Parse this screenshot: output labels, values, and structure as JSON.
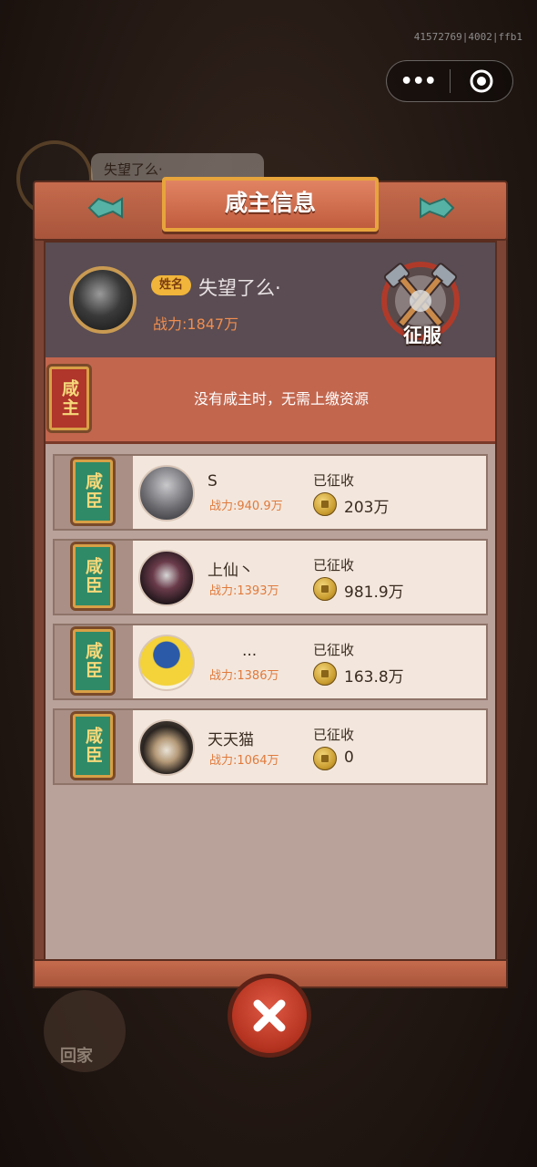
{
  "debug_id": "41572769|4002|ffb1",
  "background": {
    "speech_text": "失望了么·",
    "home_label": "回家"
  },
  "dialog": {
    "title": "咸主信息",
    "lord": {
      "name_tag": "姓名",
      "name": "失望了么·",
      "power": "战力:1847万",
      "conquer_label": "征服"
    },
    "notice": {
      "plaque": "咸主",
      "text": "没有咸主时，无需上缴资源"
    },
    "subjects": [
      {
        "plaque": "咸臣",
        "name": "S",
        "power": "战力:940.9万",
        "collected_label": "已征收",
        "collected": "203万",
        "avatar": "ninja"
      },
      {
        "plaque": "咸臣",
        "name": "上仙丶",
        "power": "战力:1393万",
        "collected_label": "已征收",
        "collected": "981.9万",
        "avatar": "dark-creature"
      },
      {
        "plaque": "咸臣",
        "name": "...",
        "power": "战力:1386万",
        "collected_label": "已征收",
        "collected": "163.8万",
        "avatar": "captain-duck"
      },
      {
        "plaque": "咸臣",
        "name": "天天猫",
        "power": "战力:1064万",
        "collected_label": "已征收",
        "collected": "0",
        "avatar": "cat"
      }
    ]
  }
}
